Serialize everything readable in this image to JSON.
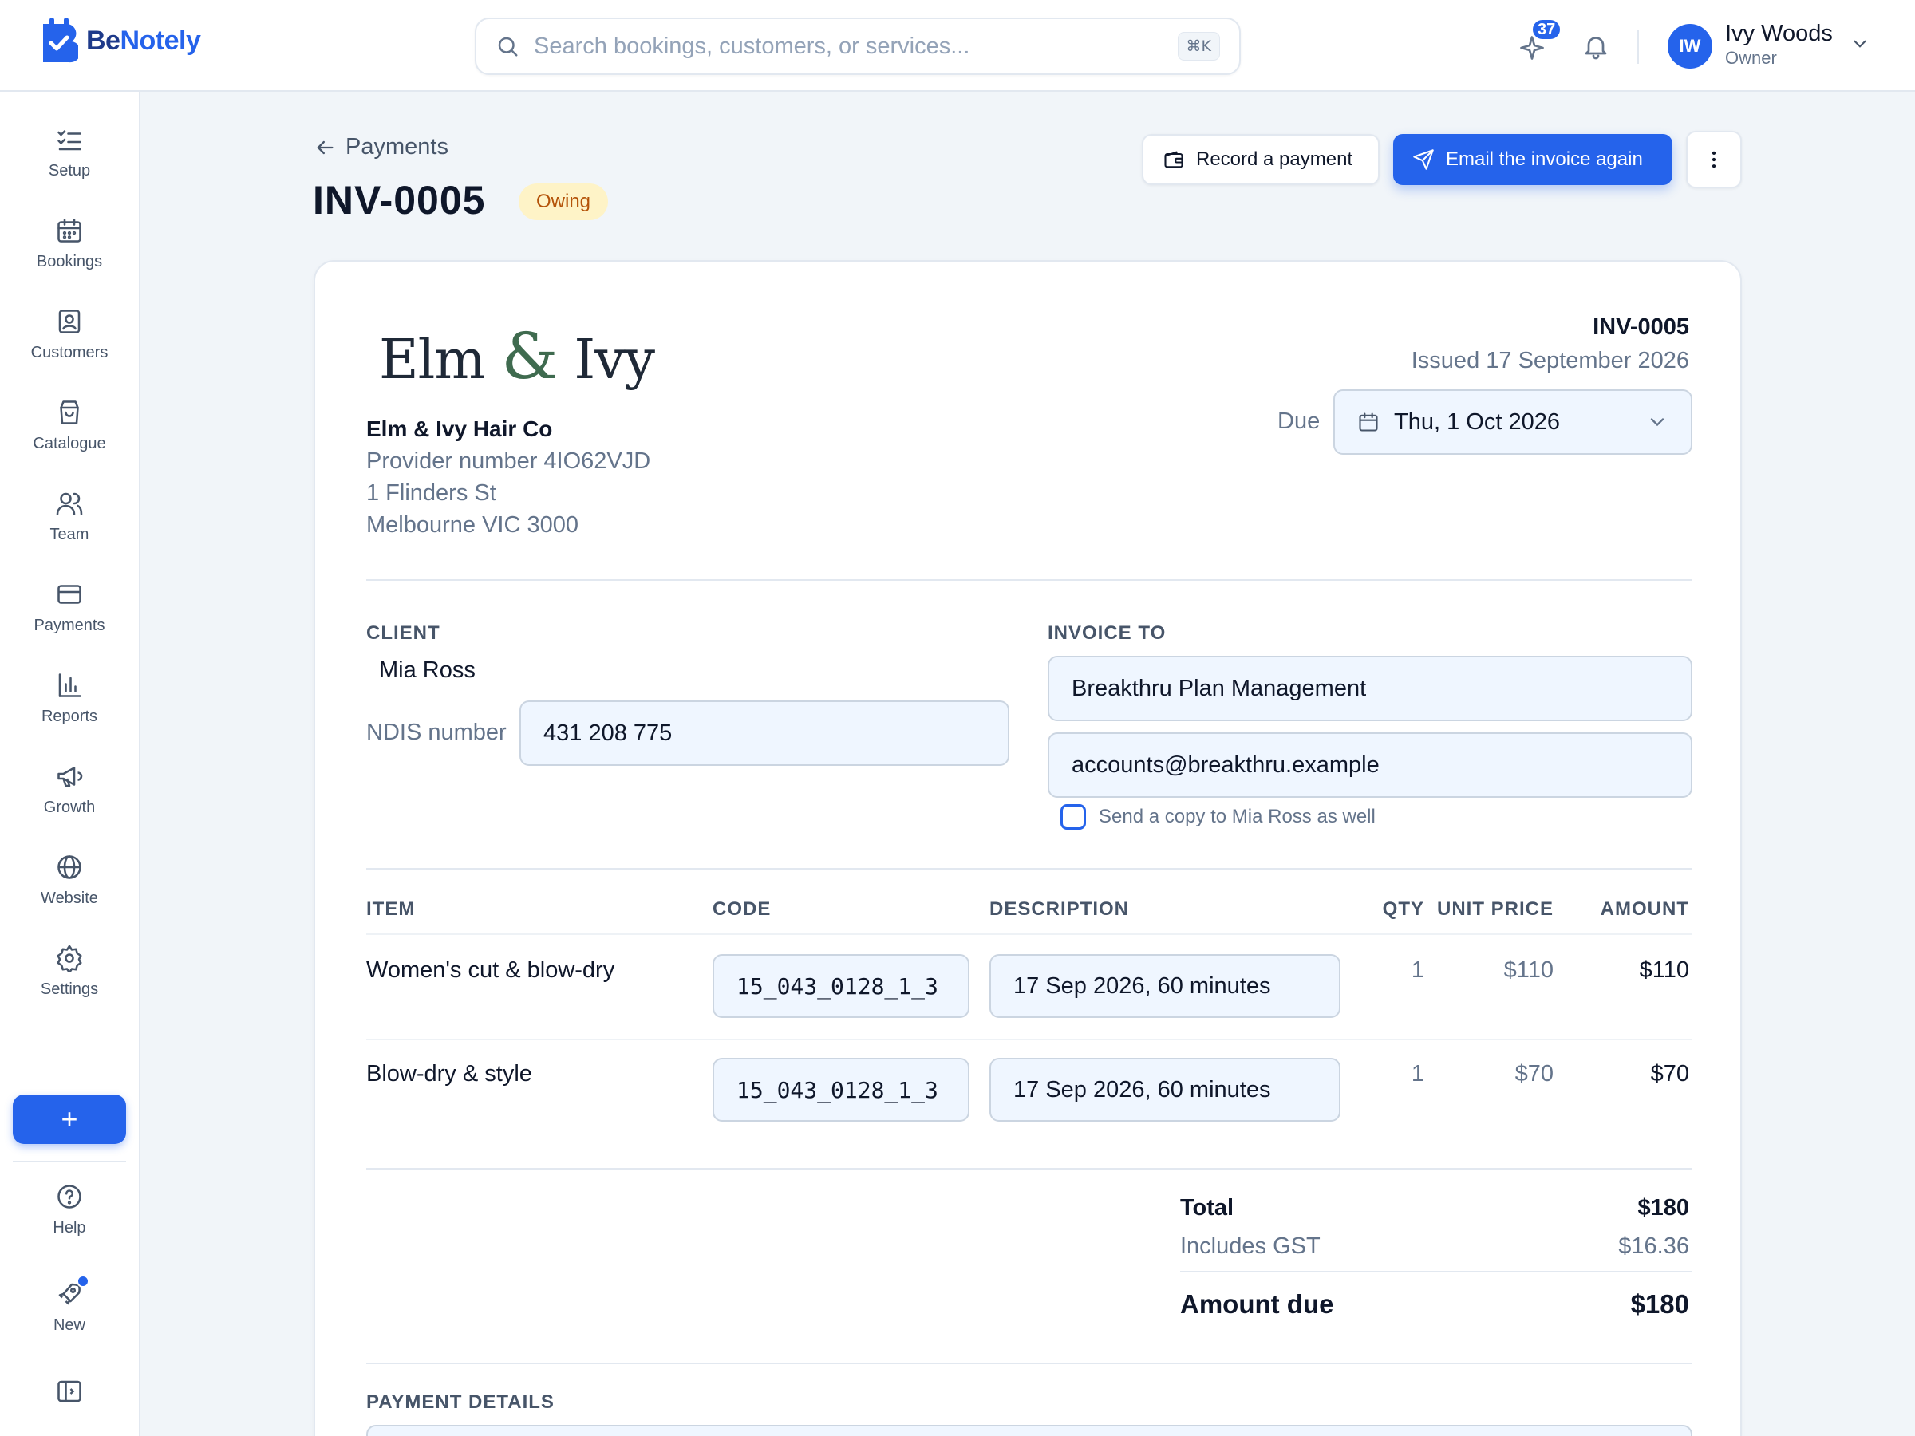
{
  "app": {
    "name_part1": "Be",
    "name_part2": "Notely"
  },
  "search": {
    "placeholder": "Search bookings, customers, or services...",
    "shortcut": "⌘K"
  },
  "topbar": {
    "whats_new_count": "37",
    "user": {
      "initials": "IW",
      "name": "Ivy Woods",
      "role": "Owner"
    }
  },
  "sidebar": {
    "items": [
      {
        "label": "Setup",
        "icon": "checklist-icon"
      },
      {
        "label": "Bookings",
        "icon": "calendar-icon"
      },
      {
        "label": "Customers",
        "icon": "contact-card-icon"
      },
      {
        "label": "Catalogue",
        "icon": "shopping-bag-icon"
      },
      {
        "label": "Team",
        "icon": "users-icon"
      },
      {
        "label": "Payments",
        "icon": "credit-card-icon"
      },
      {
        "label": "Reports",
        "icon": "bar-chart-icon"
      },
      {
        "label": "Growth",
        "icon": "megaphone-icon"
      },
      {
        "label": "Website",
        "icon": "globe-icon"
      },
      {
        "label": "Settings",
        "icon": "gear-icon"
      }
    ],
    "add_label": "+",
    "help_label": "Help",
    "new_label": "New"
  },
  "header": {
    "back_label": "Payments",
    "title": "INV-0005",
    "status": "Owing",
    "record_payment": "Record a payment",
    "email_again": "Email the invoice again"
  },
  "invoice": {
    "logo_part1": "Elm",
    "logo_amp": "&",
    "logo_part2": "Ivy",
    "business_name": "Elm & Ivy Hair Co",
    "provider_number": "Provider number 4IO62VJD",
    "address_line1": "1 Flinders St",
    "address_line2": "Melbourne VIC 3000",
    "number": "INV-0005",
    "issued": "Issued 17 September 2026",
    "due_label": "Due",
    "due_date": "Thu, 1 Oct 2026",
    "client_label": "CLIENT",
    "client_name": "Mia Ross",
    "ndis_label": "NDIS number",
    "ndis_number": "431 208 775",
    "invoice_to_label": "INVOICE TO",
    "invoice_to_name": "Breakthru Plan Management",
    "invoice_to_email": "accounts@breakthru.example",
    "send_copy_label": "Send a copy to Mia Ross as well",
    "columns": {
      "item": "ITEM",
      "code": "CODE",
      "description": "DESCRIPTION",
      "qty": "QTY",
      "unit_price": "UNIT PRICE",
      "amount": "AMOUNT"
    },
    "lines": [
      {
        "item": "Women's cut & blow-dry",
        "code": "15_043_0128_1_3",
        "description": "17 Sep 2026, 60 minutes",
        "qty": "1",
        "unit_price": "$110",
        "amount": "$110"
      },
      {
        "item": "Blow-dry & style",
        "code": "15_043_0128_1_3",
        "description": "17 Sep 2026, 60 minutes",
        "qty": "1",
        "unit_price": "$70",
        "amount": "$70"
      }
    ],
    "total_label": "Total",
    "total": "$180",
    "gst_label": "Includes GST",
    "gst": "$16.36",
    "amount_due_label": "Amount due",
    "amount_due": "$180",
    "payment_details_label": "PAYMENT DETAILS"
  },
  "colors": {
    "primary": "#2563eb",
    "owing_bg": "#fef3c7",
    "owing_text": "#b45309",
    "logo_green": "#3f6b4f"
  }
}
